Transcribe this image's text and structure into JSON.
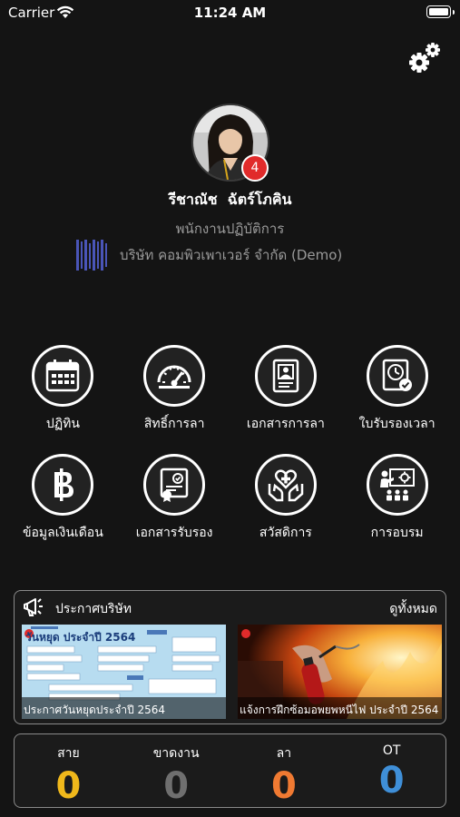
{
  "status_bar": {
    "carrier": "Carrier",
    "time": "11:24 AM"
  },
  "profile": {
    "notification_count": "4",
    "name": "รีชาณัช  ฉัตร์โภคิน",
    "position": "พนักงานปฏิบัติการ",
    "company": "บริษัท คอมพิวเพาเวอร์ จำกัด (Demo)"
  },
  "menu": [
    {
      "label": "ปฏิทิน",
      "icon": "calendar-icon"
    },
    {
      "label": "สิทธิ์การลา",
      "icon": "gauge-icon"
    },
    {
      "label": "เอกสารการลา",
      "icon": "id-document-icon"
    },
    {
      "label": "ใบรับรองเวลา",
      "icon": "clock-certificate-icon"
    },
    {
      "label": "ข้อมูลเงินเดือน",
      "icon": "baht-icon"
    },
    {
      "label": "เอกสารรับรอง",
      "icon": "certificate-icon"
    },
    {
      "label": "สวัสดิการ",
      "icon": "care-hands-icon"
    },
    {
      "label": "การอบรม",
      "icon": "training-icon"
    }
  ],
  "announcements": {
    "title": "ประกาศบริษัท",
    "see_all": "ดูทั้งหมด",
    "items": [
      {
        "caption": "ประกาศวันหยุดประจำปี 2564",
        "image_text": "วันหยุด ประจำปี 2564"
      },
      {
        "caption": "แจ้งการฝึกซ้อมอพยพหนีไฟ  ประจำปี  2564"
      }
    ]
  },
  "stats": [
    {
      "label": "สาย",
      "value": "0",
      "color": "#f0b81b"
    },
    {
      "label": "ขาดงาน",
      "value": "0",
      "color": "#6f6f6f"
    },
    {
      "label": "ลา",
      "value": "0",
      "color": "#f07a32"
    },
    {
      "label": "OT",
      "value": "0",
      "color": "#3f8fd8"
    }
  ]
}
